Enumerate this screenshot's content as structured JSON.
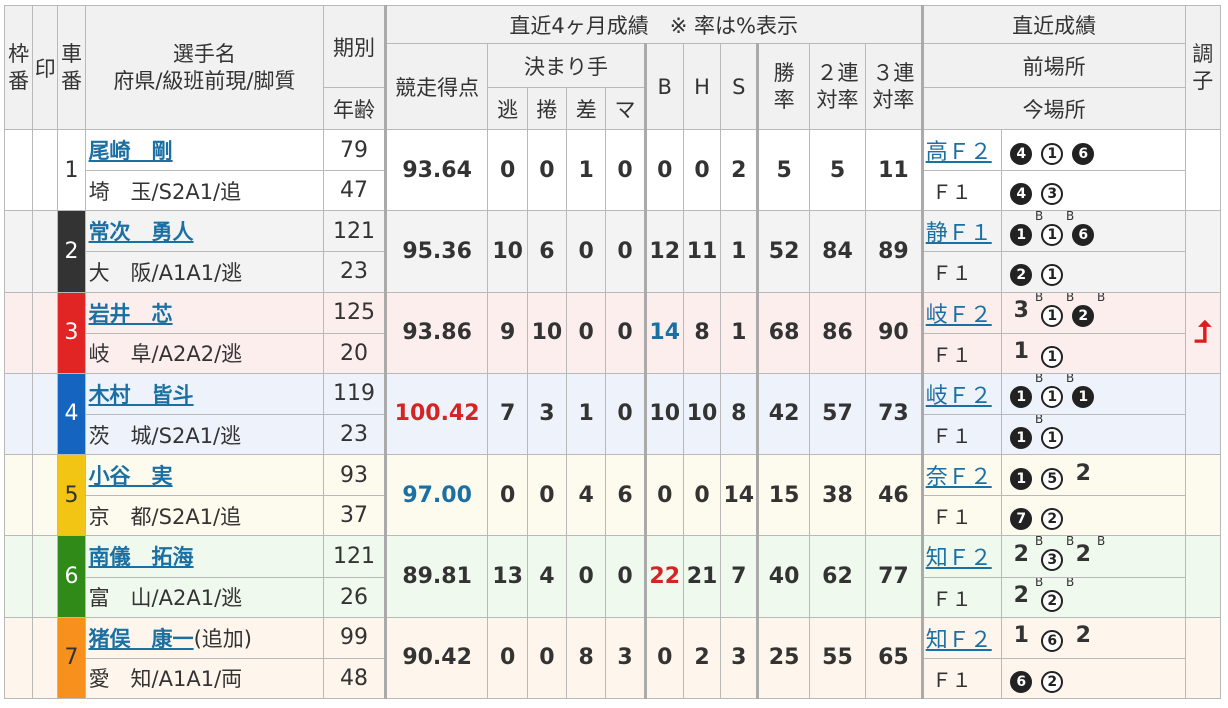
{
  "header": {
    "waku": "枠番",
    "mark": "印",
    "sha": "車番",
    "player": "選手名",
    "player_sub": "府県/級班前現/脚質",
    "kibetsu": "期別",
    "age": "年齢",
    "recent4": "直近4ヶ月成績　※ 率は%表示",
    "score": "競走得点",
    "kimari": "決まり手",
    "nige": "逃",
    "makuri": "捲",
    "sashi": "差",
    "mark2": "マ",
    "b": "B",
    "h": "H",
    "s": "S",
    "win1": "勝",
    "win2": "率",
    "ren2a": "２連",
    "ren2b": "対率",
    "ren3a": "３連",
    "ren3b": "対率",
    "recent": "直近成績",
    "prev_venue": "前場所",
    "cur_venue": "今場所",
    "cond": "調子"
  },
  "colors": {
    "1": {
      "bg": "#ffffff",
      "fg": "#333333",
      "row": "#ffffff"
    },
    "2": {
      "bg": "#333333",
      "fg": "#ffffff",
      "row": "#f3f3f3"
    },
    "3": {
      "bg": "#e12424",
      "fg": "#ffffff",
      "row": "#fdeeee"
    },
    "4": {
      "bg": "#1565c0",
      "fg": "#ffffff",
      "row": "#eef3fb"
    },
    "5": {
      "bg": "#f2c414",
      "fg": "#333333",
      "row": "#fdfaee"
    },
    "6": {
      "bg": "#2f8a18",
      "fg": "#ffffff",
      "row": "#f0f9ed"
    },
    "7": {
      "bg": "#f8901e",
      "fg": "#333333",
      "row": "#fef6ec"
    }
  },
  "riders": [
    {
      "sha": "1",
      "name": "尾崎　剛",
      "extra": "",
      "info": "埼　玉/S2A1/追",
      "kibetsu": "79",
      "age": "47",
      "score": "93.64",
      "score_color": "",
      "kimari": [
        "0",
        "0",
        "1",
        "0"
      ],
      "bhs": [
        "0",
        "0",
        "2"
      ],
      "b_color": "",
      "rates": [
        "5",
        "5",
        "11"
      ],
      "zen_label": "高Ｆ２",
      "zen": [
        {
          "t": "4",
          "s": "filled",
          "sup": ""
        },
        {
          "t": "1",
          "s": "open",
          "sup": ""
        },
        {
          "t": "6",
          "s": "filled",
          "sup": ""
        }
      ],
      "kon_label": "Ｆ１",
      "kon": [
        {
          "t": "4",
          "s": "filled",
          "sup": ""
        },
        {
          "t": "3",
          "s": "open",
          "sup": ""
        }
      ],
      "cond": ""
    },
    {
      "sha": "2",
      "name": "常次　勇人",
      "extra": "",
      "info": "大　阪/A1A1/逃",
      "kibetsu": "121",
      "age": "23",
      "score": "95.36",
      "score_color": "",
      "kimari": [
        "10",
        "6",
        "0",
        "0"
      ],
      "bhs": [
        "12",
        "11",
        "1"
      ],
      "b_color": "",
      "rates": [
        "52",
        "84",
        "89"
      ],
      "zen_label": "静Ｆ１",
      "zen": [
        {
          "t": "1",
          "s": "filled",
          "sup": "B"
        },
        {
          "t": "1",
          "s": "open",
          "sup": "B"
        },
        {
          "t": "6",
          "s": "filled",
          "sup": ""
        }
      ],
      "kon_label": "Ｆ１",
      "kon": [
        {
          "t": "2",
          "s": "filled",
          "sup": ""
        },
        {
          "t": "1",
          "s": "open",
          "sup": ""
        }
      ],
      "cond": ""
    },
    {
      "sha": "3",
      "name": "岩井　芯",
      "extra": "",
      "info": "岐　阜/A2A2/逃",
      "kibetsu": "125",
      "age": "20",
      "score": "93.86",
      "score_color": "",
      "kimari": [
        "9",
        "10",
        "0",
        "0"
      ],
      "bhs": [
        "14",
        "8",
        "1"
      ],
      "b_color": "blue",
      "rates": [
        "68",
        "86",
        "90"
      ],
      "zen_label": "岐Ｆ２",
      "zen": [
        {
          "t": "3",
          "s": "plain",
          "sup": "B"
        },
        {
          "t": "1",
          "s": "open",
          "sup": "B"
        },
        {
          "t": "2",
          "s": "filled",
          "sup": "B"
        }
      ],
      "kon_label": "Ｆ１",
      "kon": [
        {
          "t": "1",
          "s": "plain",
          "sup": ""
        },
        {
          "t": "1",
          "s": "open",
          "sup": ""
        }
      ],
      "cond": "⮥"
    },
    {
      "sha": "4",
      "name": "木村　皆斗",
      "extra": "",
      "info": "茨　城/S2A1/逃",
      "kibetsu": "119",
      "age": "23",
      "score": "100.42",
      "score_color": "red",
      "kimari": [
        "7",
        "3",
        "1",
        "0"
      ],
      "bhs": [
        "10",
        "10",
        "8"
      ],
      "b_color": "",
      "rates": [
        "42",
        "57",
        "73"
      ],
      "zen_label": "岐Ｆ２",
      "zen": [
        {
          "t": "1",
          "s": "filled",
          "sup": "B"
        },
        {
          "t": "1",
          "s": "open",
          "sup": "B"
        },
        {
          "t": "1",
          "s": "filled",
          "sup": ""
        }
      ],
      "kon_label": "Ｆ１",
      "kon": [
        {
          "t": "1",
          "s": "filled",
          "sup": "B"
        },
        {
          "t": "1",
          "s": "open",
          "sup": ""
        }
      ],
      "cond": ""
    },
    {
      "sha": "5",
      "name": "小谷　実",
      "extra": "",
      "info": "京　都/S2A1/追",
      "kibetsu": "93",
      "age": "37",
      "score": "97.00",
      "score_color": "blue",
      "kimari": [
        "0",
        "0",
        "4",
        "6"
      ],
      "bhs": [
        "0",
        "0",
        "14"
      ],
      "b_color": "",
      "rates": [
        "15",
        "38",
        "46"
      ],
      "zen_label": "奈Ｆ２",
      "zen": [
        {
          "t": "1",
          "s": "filled",
          "sup": ""
        },
        {
          "t": "5",
          "s": "open",
          "sup": ""
        },
        {
          "t": "2",
          "s": "plain",
          "sup": ""
        }
      ],
      "kon_label": "Ｆ１",
      "kon": [
        {
          "t": "7",
          "s": "filled",
          "sup": ""
        },
        {
          "t": "2",
          "s": "open",
          "sup": ""
        }
      ],
      "cond": ""
    },
    {
      "sha": "6",
      "name": "南儀　拓海",
      "extra": "",
      "info": "富　山/A2A1/逃",
      "kibetsu": "121",
      "age": "26",
      "score": "89.81",
      "score_color": "",
      "kimari": [
        "13",
        "4",
        "0",
        "0"
      ],
      "bhs": [
        "22",
        "21",
        "7"
      ],
      "b_color": "red",
      "rates": [
        "40",
        "62",
        "77"
      ],
      "zen_label": "知Ｆ２",
      "zen": [
        {
          "t": "2",
          "s": "plain",
          "sup": "B"
        },
        {
          "t": "3",
          "s": "open",
          "sup": "B"
        },
        {
          "t": "2",
          "s": "plain",
          "sup": "B"
        }
      ],
      "kon_label": "Ｆ１",
      "kon": [
        {
          "t": "2",
          "s": "plain",
          "sup": "B"
        },
        {
          "t": "2",
          "s": "open",
          "sup": "B"
        }
      ],
      "cond": ""
    },
    {
      "sha": "7",
      "name": "猪俣　康一",
      "extra": "(追加)",
      "info": "愛　知/A1A1/両",
      "kibetsu": "99",
      "age": "48",
      "score": "90.42",
      "score_color": "",
      "kimari": [
        "0",
        "0",
        "8",
        "3"
      ],
      "bhs": [
        "0",
        "2",
        "3"
      ],
      "b_color": "",
      "rates": [
        "25",
        "55",
        "65"
      ],
      "zen_label": "知Ｆ２",
      "zen": [
        {
          "t": "1",
          "s": "plain",
          "sup": ""
        },
        {
          "t": "6",
          "s": "open",
          "sup": ""
        },
        {
          "t": "2",
          "s": "plain",
          "sup": ""
        }
      ],
      "kon_label": "Ｆ１",
      "kon": [
        {
          "t": "6",
          "s": "filled",
          "sup": ""
        },
        {
          "t": "2",
          "s": "open",
          "sup": ""
        }
      ],
      "cond": ""
    }
  ]
}
